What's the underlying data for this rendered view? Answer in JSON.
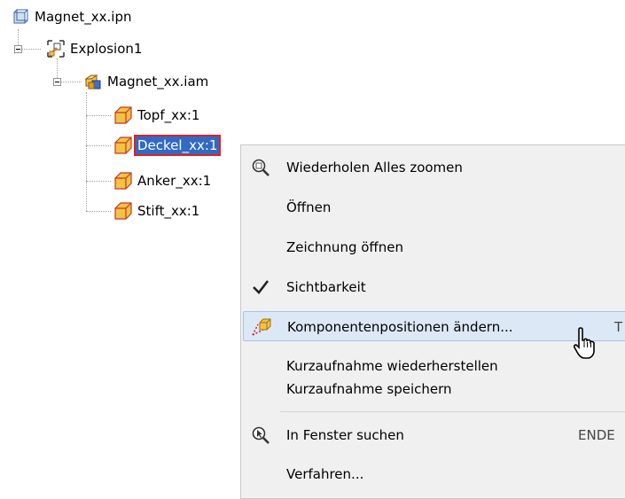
{
  "tree": {
    "root": {
      "label": "Magnet_xx.ipn",
      "icon": "presentation-file-icon"
    },
    "explosion": {
      "label": "Explosion1",
      "icon": "explosion-view-icon"
    },
    "assembly": {
      "label": "Magnet_xx.iam",
      "icon": "assembly-icon"
    },
    "parts": [
      {
        "label": "Topf_xx:1",
        "icon": "part-icon"
      },
      {
        "label": "Deckel_xx:1",
        "icon": "part-icon",
        "selected": true
      },
      {
        "label": "Anker_xx:1",
        "icon": "part-icon"
      },
      {
        "label": "Stift_xx:1",
        "icon": "part-icon"
      }
    ]
  },
  "menu": {
    "items": [
      {
        "label": "Wiederholen Alles zoomen",
        "icon": "zoom-all-icon",
        "shortcut": ""
      },
      {
        "label": "Öffnen",
        "icon": "",
        "shortcut": ""
      },
      {
        "label": "Zeichnung öffnen",
        "icon": "",
        "shortcut": ""
      },
      {
        "label": "Sichtbarkeit",
        "icon": "checkmark-icon",
        "shortcut": ""
      },
      {
        "label": "Komponentenpositionen ändern...",
        "icon": "tweak-components-icon",
        "shortcut": "T"
      },
      {
        "label": "Kurzaufnahme wiederherstellen",
        "icon": "",
        "shortcut": ""
      },
      {
        "label": "Kurzaufnahme speichern",
        "icon": "",
        "shortcut": ""
      },
      {
        "label": "In Fenster suchen",
        "icon": "find-in-window-icon",
        "shortcut": "ENDE"
      },
      {
        "label": "Verfahren...",
        "icon": "",
        "shortcut": ""
      }
    ]
  },
  "colors": {
    "selection": "#316ac5",
    "selection_outline": "#e02020",
    "menu_background": "#f0f0f0",
    "menu_hover": "#dde8f6",
    "part_icon": "#f5c242"
  },
  "cursor": "hand-pointer-icon"
}
